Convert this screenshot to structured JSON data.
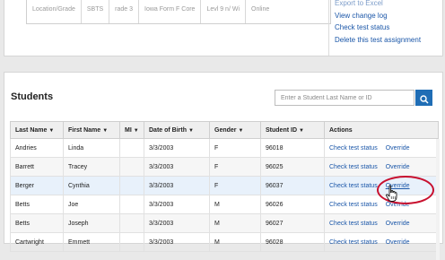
{
  "top_table": {
    "cells": [
      "Location/Grade",
      "SBTS",
      "rade 3",
      "Iowa Form F Core",
      "Levl 9 n/ Wi",
      "Online"
    ]
  },
  "side_links": [
    "Export to Excel",
    "View change log",
    "Check test status",
    "Delete this test assignment"
  ],
  "students": {
    "title": "Students",
    "search_placeholder": "Enter a Student Last Name or ID",
    "columns": [
      "Last Name",
      "First Name",
      "MI",
      "Date of Birth",
      "Gender",
      "Student ID",
      "Actions"
    ],
    "action_labels": {
      "check": "Check test status",
      "override": "Override"
    },
    "rows": [
      {
        "last": "Andries",
        "first": "Linda",
        "mi": "",
        "dob": "3/3/2003",
        "gender": "F",
        "id": "96018"
      },
      {
        "last": "Barrett",
        "first": "Tracey",
        "mi": "",
        "dob": "3/3/2003",
        "gender": "F",
        "id": "96025"
      },
      {
        "last": "Berger",
        "first": "Cynthia",
        "mi": "",
        "dob": "3/3/2003",
        "gender": "F",
        "id": "96037"
      },
      {
        "last": "Betts",
        "first": "Joe",
        "mi": "",
        "dob": "3/3/2003",
        "gender": "M",
        "id": "96026"
      },
      {
        "last": "Betts",
        "first": "Joseph",
        "mi": "",
        "dob": "3/3/2003",
        "gender": "M",
        "id": "96027"
      },
      {
        "last": "Cartwright",
        "first": "Emmett",
        "mi": "",
        "dob": "3/3/2003",
        "gender": "M",
        "id": "96028"
      }
    ]
  },
  "colors": {
    "link": "#1a56a8",
    "search_button": "#1f6db5",
    "annotation_ring": "#c8102e"
  }
}
